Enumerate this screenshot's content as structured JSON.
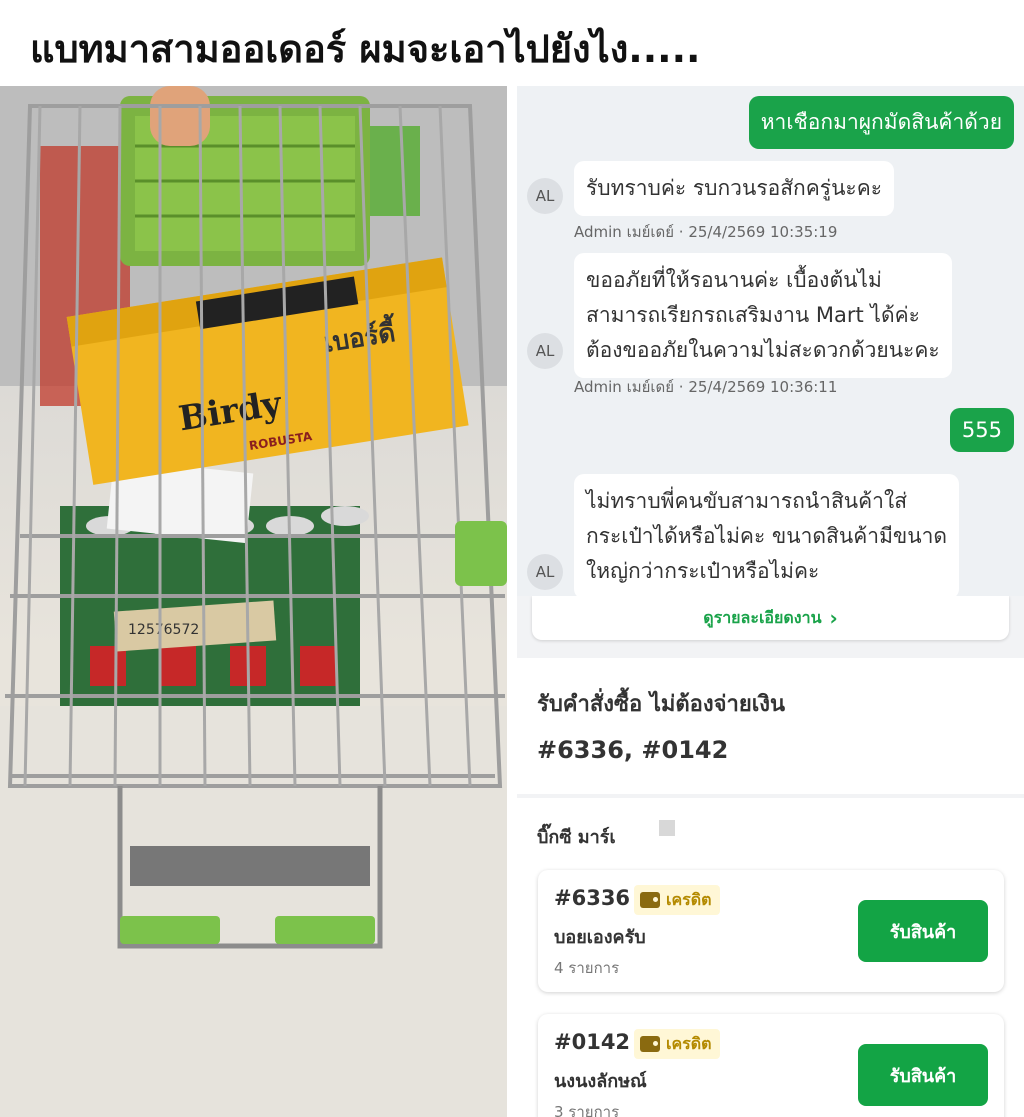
{
  "headline": "แบทมาสามออเดอร์ ผมจะเอาไปยังไง.....",
  "photo": {
    "box_brand_thai": "เบอร์ดี้",
    "box_brand": "Birdy",
    "box_tag": "ROBUSTA",
    "receipt_code": "12576572"
  },
  "chat": {
    "msg1": "หาเชือกมาผูกมัดสินค้าด้วย",
    "msg2": "รับทราบค่ะ รบกวนรอสักครู่นะคะ",
    "meta2": "Admin เมย์เดย์ · 25/4/2569 10:35:19",
    "msg3_line1": "ขออภัยที่ให้รอนานค่ะ เบื้องต้นไม่",
    "msg3_line2": "สามารถเรียกรถเสริมงาน Mart ได้ค่ะ",
    "msg3_line3": "ต้องขออภัยในความไม่สะดวกด้วยนะคะ",
    "meta3": "Admin เมย์เดย์ · 25/4/2569 10:36:11",
    "msg4": "555",
    "msg5_line1": "ไม่ทราบพี่คนขับสามารถนำสินค้าใส่",
    "msg5_line2": "กระเป๋าได้หรือไม่คะ ขนาดสินค้ามีขนาด",
    "msg5_line3": "ใหญ่กว่ากระเป๋าหรือไม่คะ",
    "avatar": "AL"
  },
  "orders": {
    "detail_link": "ดูรายละเอียดงาน",
    "title": "รับคำสั่งซื้อ ไม่ต้องจ่ายเงิน",
    "numbers": "#6336, #0142",
    "store": "บิ๊กซี มาร์เ",
    "cards": [
      {
        "id": "#6336",
        "badge": "เครดิต",
        "name": "บอยเองครับ",
        "items": "4 รายการ",
        "button": "รับสินค้า"
      },
      {
        "id": "#0142",
        "badge": "เครดิต",
        "name": "นงนงลักษณ์",
        "items": "3 รายการ",
        "button": "รับสินค้า"
      }
    ]
  }
}
